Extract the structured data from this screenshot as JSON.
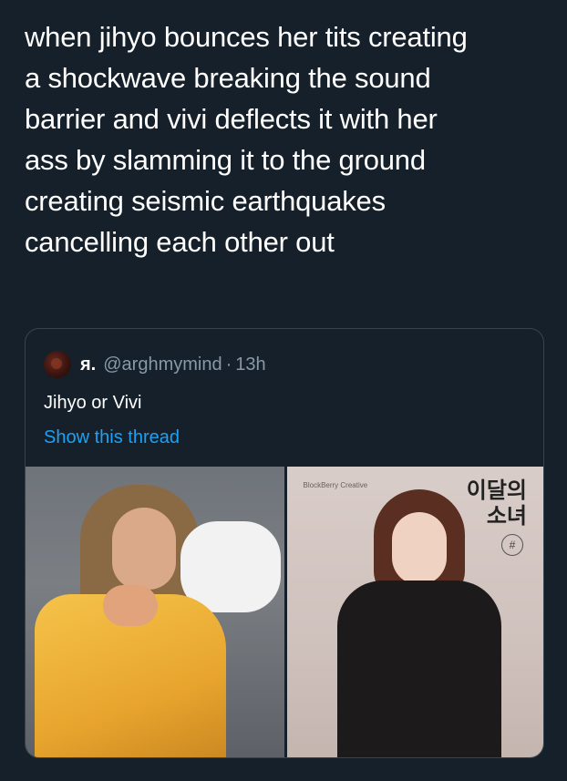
{
  "tweet": {
    "lines": [
      "when jihyo bounces her tits creating",
      "a shockwave breaking the sound",
      "barrier and vivi deflects it with her",
      "ass by slamming it to the ground",
      "creating seismic earthquakes",
      "cancelling each other out"
    ]
  },
  "quote": {
    "display_name": "я.",
    "handle": "@arghmymind",
    "separator": "·",
    "time": "13h",
    "text": "Jihyo or Vivi",
    "show_thread": "Show this thread",
    "media": {
      "right_photo": {
        "brand": "BlockBerry Creative",
        "korean_title_line1": "이달의",
        "korean_title_line2": "소녀",
        "hash": "#"
      }
    }
  },
  "colors": {
    "background": "#15202b",
    "link": "#1da1f2",
    "muted": "#8899a6",
    "border": "#38444d"
  }
}
